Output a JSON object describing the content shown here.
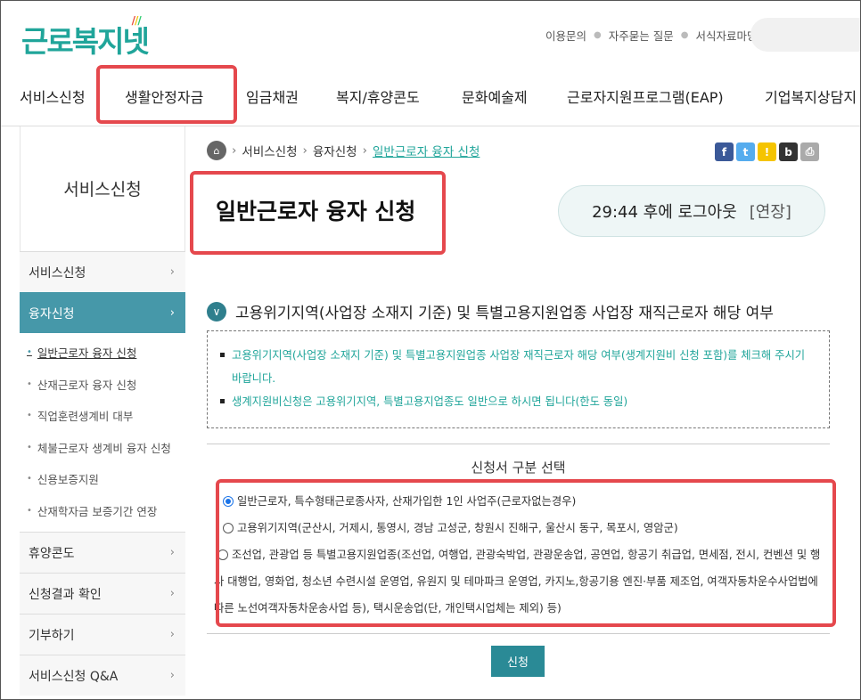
{
  "header": {
    "logo_main": "근로복지넷",
    "utils": [
      "이용문의",
      "자주묻는 질문",
      "서식자료마당"
    ]
  },
  "gnb": [
    "서비스신청",
    "생활안정자금",
    "임금채권",
    "복지/휴양콘도",
    "문화예술제",
    "근로자지원프로그램(EAP)",
    "기업복지상담지"
  ],
  "lnb": {
    "title": "서비스신청",
    "menus": [
      {
        "label": "서비스신청"
      },
      {
        "label": "융자신청",
        "subs": [
          "일반근로자 융자 신청",
          "산재근로자 융자 신청",
          "직업훈련생계비 대부",
          "체불근로자 생계비 융자 신청",
          "신용보증지원",
          "산재학자금 보증기간 연장"
        ]
      },
      {
        "label": "휴양콘도"
      },
      {
        "label": "신청결과 확인"
      },
      {
        "label": "기부하기"
      },
      {
        "label": "서비스신청 Q&A"
      }
    ]
  },
  "breadcrumb": {
    "items": [
      "서비스신청",
      "융자신청",
      "일반근로자 융자 신청"
    ]
  },
  "page_title": "일반근로자 융자 신청",
  "timer": {
    "text": "29:44 후에 로그아웃",
    "extend": "[연장]"
  },
  "section": {
    "title": "고용위기지역(사업장 소재지 기준) 및 특별고용지원업종 사업장 재직근로자 해당 여부",
    "notices": [
      "고용위기지역(사업장 소재지 기준) 및 특별고용지원업종 사업장 재직근로자 해당 여부(생계지원비 신청 포함)를 체크해 주시기 바랍니다.",
      "생계지원비신청은 고용위기지역, 특별고용지업종도 일반으로 하시면 됩니다(한도 동일)"
    ]
  },
  "form": {
    "select_title": "신청서 구분 선택",
    "options": [
      "일반근로자, 특수형태근로종사자, 산재가입한 1인 사업주(근로자없는경우)",
      "고용위기지역(군산시, 거제시, 통영시, 경남 고성군, 창원시 진해구, 울산시 동구, 목포시, 영암군)",
      "조선업, 관광업 등 특별고용지원업종(조선업, 여행업, 관광숙박업, 관광운송업, 공연업, 항공기 취급업, 면세점, 전시, 컨벤션 및 행사 대행업, 영화업, 청소년 수련시설 운영업, 유원지 및 테마파크 운영업, 카지노,항공기용 엔진·부품 제조업, 여객자동차운수사업법에 따른 노선여객자동차운송사업 등), 택시운송업(단, 개인택시업체는 제외) 등)"
    ],
    "selected_index": 0,
    "submit_label": "신청"
  },
  "colors": {
    "accent": "#20a59a",
    "lnb_active": "#4698a9",
    "highlight": "#e5484d",
    "button": "#2a8a96"
  }
}
